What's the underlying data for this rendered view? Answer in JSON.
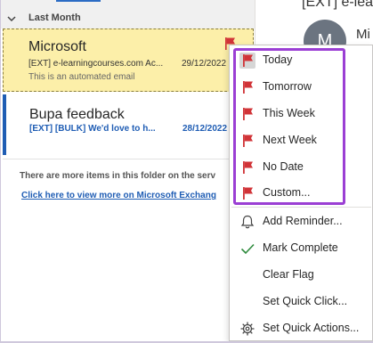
{
  "colors": {
    "flag_red": "#d13438",
    "link_blue": "#1f5db4",
    "flagged_bg": "#fcefa9",
    "menu_highlight_border": "#9b3fd4",
    "check_green": "#2e8b3d"
  },
  "list": {
    "group_label": "Last Month",
    "messages": [
      {
        "sender": "Microsoft",
        "subject": "[EXT] e-learningcourses.com Ac...",
        "date": "29/12/2022",
        "preview": "This is an automated email",
        "flagged": true
      },
      {
        "sender": "Bupa feedback",
        "subject": "[EXT] [BULK] We'd love to h...",
        "date": "28/12/2022",
        "unread": true
      }
    ],
    "more_info": "There are more items in this folder on the serv",
    "more_link": "Click here to view more on Microsoft Exchang"
  },
  "reading": {
    "header": "[EXT] e-lear",
    "avatar_initial": "M",
    "name": "Mi"
  },
  "context_menu": {
    "items": [
      {
        "label": "Today",
        "icon": "flag-icon"
      },
      {
        "label": "Tomorrow",
        "icon": "flag-icon"
      },
      {
        "label": "This Week",
        "icon": "flag-icon"
      },
      {
        "label": "Next Week",
        "icon": "flag-icon"
      },
      {
        "label": "No Date",
        "icon": "flag-icon"
      },
      {
        "label": "Custom...",
        "icon": "flag-icon"
      },
      {
        "label": "Add Reminder...",
        "icon": "bell-icon"
      },
      {
        "label": "Mark Complete",
        "icon": "checkmark-icon"
      },
      {
        "label": "Clear Flag",
        "icon": ""
      },
      {
        "label": "Set Quick Click...",
        "icon": ""
      },
      {
        "label": "Set Quick Actions...",
        "icon": "gear-icon"
      }
    ]
  }
}
